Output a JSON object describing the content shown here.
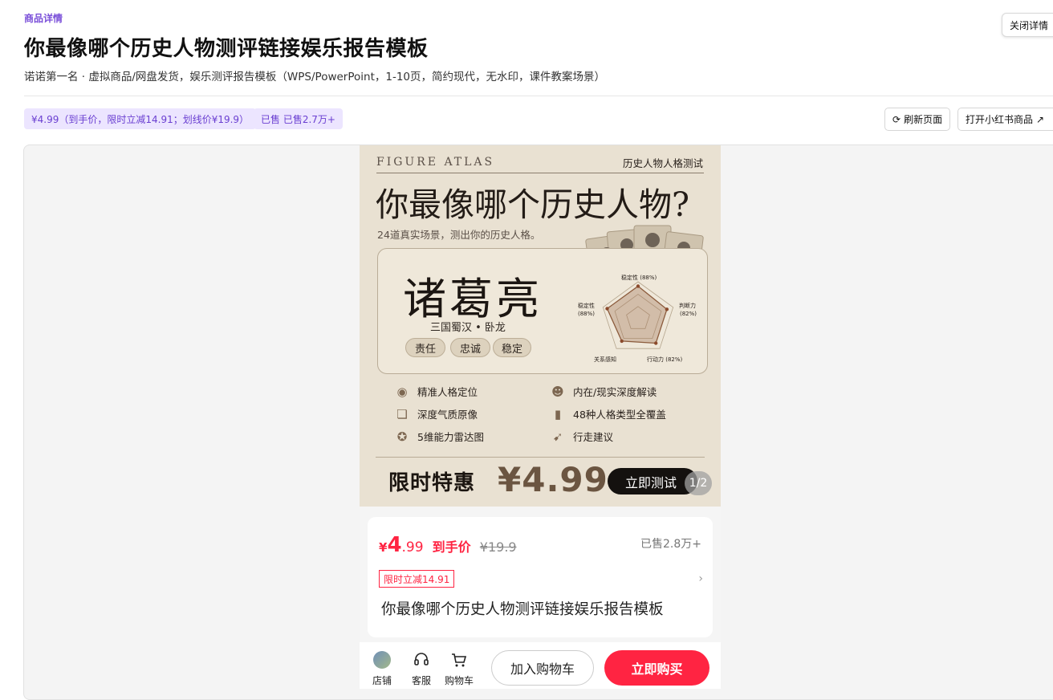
{
  "header": {
    "eyebrow": "商品详情",
    "title": "你最像哪个历史人物测评链接娱乐报告模板",
    "subtitle": "诺诺第一名 · 虚拟商品/网盘发货，娱乐测评报告模板（WPS/PowerPoint，1-10页，简约现代，无水印，课件教案场景）",
    "close_label": "关闭详情"
  },
  "chips": {
    "price": "¥4.99（到手价，限时立减14.91；划线价¥19.9）",
    "sold": "已售 已售2.7万+"
  },
  "toolbar": {
    "refresh_label": "刷新页面",
    "open_label": "打开小红书商品"
  },
  "poster": {
    "brand": "FIGURE ATLAS",
    "tag": "历史人物人格测试",
    "headline": "你最像哪个历史人物?",
    "subline": "24道真实场景，测出你的历史人格。",
    "name": "诸葛亮",
    "era": "三国蜀汉 • 卧龙",
    "traits": [
      "责任",
      "忠诚",
      "稳定"
    ],
    "radar": {
      "top": "稳定性 (88%)",
      "right1": "判断力",
      "right2": "(82%)",
      "left1": "稳定性",
      "left2": "(88%)",
      "bl": "关系感知",
      "br": "行动力 (82%)",
      "levels": [
        0.88,
        0.82,
        0.82,
        0.75,
        0.88
      ]
    },
    "features": [
      "精准人格定位",
      "内在/现实深度解读",
      "深度气质原像",
      "48种人格类型全覆盖",
      "5维能力雷达图",
      "行走建议"
    ],
    "promo": "限时特惠",
    "price": "¥4.99",
    "cta": "立即测试",
    "pager": "1/2"
  },
  "product": {
    "currency": "¥",
    "price_int": "4",
    "price_dec": ".99",
    "price_label": "到手价",
    "original_price": "¥19.9",
    "sold": "已售2.8万+",
    "discount": "限时立减14.91",
    "title": "你最像哪个历史人物测评链接娱乐报告模板"
  },
  "bottom_bar": {
    "shop": "店铺",
    "service": "客服",
    "cart": "购物车",
    "add_cart": "加入购物车",
    "buy_now": "立即购买"
  },
  "colors": {
    "accent": "#7a4fd9",
    "chip_bg": "#ece5ff",
    "price_red": "#ff2442",
    "poster_bg": "#e9e1d2"
  }
}
